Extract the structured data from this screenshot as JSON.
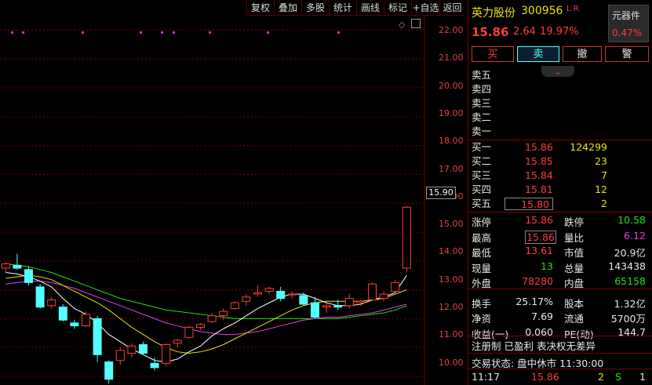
{
  "toolbar": [
    "复权",
    "叠加",
    "多股",
    "统计",
    "画线",
    "标记",
    "+自选",
    "返回"
  ],
  "y_axis": [
    "22.00",
    "21.00",
    "20.00",
    "19.00",
    "18.00",
    "17.00",
    "16.00",
    "15.00",
    "14.00",
    "13.00",
    "12.00",
    "11.00",
    "10.00"
  ],
  "current_price_marker": "15.90",
  "stock": {
    "name": "英力股份",
    "code": "300956",
    "tags": "L R",
    "price": "15.86",
    "change": "2.64",
    "change_pct": "19.97%",
    "unit_label": "元器件",
    "unit_pct": "0.47%"
  },
  "actions": [
    "买",
    "卖",
    "撤",
    "警"
  ],
  "sell_levels": [
    "卖五",
    "卖四",
    "卖三",
    "卖二",
    "卖一"
  ],
  "buy_levels": [
    {
      "label": "买一",
      "price": "15.86",
      "volume": "124299"
    },
    {
      "label": "买二",
      "price": "15.85",
      "volume": "23"
    },
    {
      "label": "买三",
      "price": "15.84",
      "volume": "7"
    },
    {
      "label": "买四",
      "price": "15.81",
      "volume": "12"
    },
    {
      "label": "买五",
      "price": "15.80",
      "volume": "2"
    }
  ],
  "stats": {
    "zhangting_label": "涨停",
    "zhangting": "15.86",
    "dieting_label": "跌停",
    "dieting": "10.58",
    "high_label": "最高",
    "high": "15.86",
    "liangbi_label": "量比",
    "liangbi": "6.12",
    "low_label": "最低",
    "low": "13.61",
    "shizhi_label": "市值",
    "shizhi": "20.9亿",
    "xianliang_label": "现量",
    "xianliang": "13",
    "zongliang_label": "总量",
    "zongliang": "143438",
    "waipan_label": "外盘",
    "waipan": "78280",
    "neipan_label": "内盘",
    "neipan": "65158",
    "huanshou_label": "换手",
    "huanshou": "25.17%",
    "guben_label": "股本",
    "guben": "1.32亿",
    "jingzi_label": "净资",
    "jingzi": "7.69",
    "liutong_label": "流通",
    "liutong": "5700万",
    "shouyi_label": "收益(一)",
    "shouyi": "0.060",
    "pe_label": "PE(动)",
    "pe": "144.7"
  },
  "info_line": "注册制 已盈利 表决权无差异",
  "status_line": "交易状态: 盘中休市 11:30:00",
  "tick": {
    "time": "11:17",
    "price": "15.86",
    "volume": "2",
    "side": "S",
    "count": "1"
  },
  "colors": {
    "up": "#ff3b3b",
    "down": "#54ffff",
    "ma5": "#ffffff",
    "ma10": "#e6e600",
    "ma20": "#e040e0",
    "ma60": "#22dd22"
  },
  "chart_data": {
    "type": "candlestick",
    "ylim": [
      9.7,
      22.5
    ],
    "ohlc": [
      [
        13.75,
        13.95,
        13.6,
        13.9
      ],
      [
        13.85,
        14.25,
        13.7,
        13.75
      ],
      [
        13.7,
        13.8,
        13.15,
        13.25
      ],
      [
        13.1,
        13.2,
        12.35,
        12.4
      ],
      [
        12.45,
        12.75,
        12.35,
        12.65
      ],
      [
        12.4,
        12.5,
        11.9,
        11.95
      ],
      [
        11.85,
        11.95,
        11.65,
        11.75
      ],
      [
        11.75,
        12.25,
        11.7,
        12.15
      ],
      [
        12.0,
        12.1,
        10.5,
        10.75
      ],
      [
        10.5,
        10.55,
        9.75,
        9.9
      ],
      [
        10.55,
        11.0,
        10.4,
        10.9
      ],
      [
        10.8,
        11.15,
        10.65,
        11.05
      ],
      [
        11.1,
        11.2,
        10.75,
        10.8
      ],
      [
        10.45,
        10.65,
        10.2,
        10.3
      ],
      [
        10.45,
        11.15,
        10.35,
        11.1
      ],
      [
        11.15,
        11.3,
        11.0,
        11.25
      ],
      [
        11.35,
        11.75,
        11.3,
        11.7
      ],
      [
        11.7,
        11.85,
        11.6,
        11.8
      ],
      [
        11.9,
        12.2,
        11.85,
        12.1
      ],
      [
        12.1,
        12.35,
        11.95,
        12.25
      ],
      [
        12.35,
        12.6,
        12.3,
        12.55
      ],
      [
        12.6,
        12.85,
        12.45,
        12.75
      ],
      [
        12.85,
        13.15,
        12.75,
        12.9
      ],
      [
        12.95,
        13.1,
        12.85,
        13.05
      ],
      [
        12.95,
        13.1,
        12.6,
        12.7
      ],
      [
        12.85,
        12.95,
        12.7,
        12.85
      ],
      [
        12.8,
        12.9,
        12.45,
        12.5
      ],
      [
        12.55,
        12.75,
        12.0,
        12.05
      ],
      [
        12.4,
        12.55,
        12.2,
        12.45
      ],
      [
        12.45,
        12.65,
        12.3,
        12.4
      ],
      [
        12.45,
        12.85,
        12.35,
        12.7
      ],
      [
        12.55,
        12.65,
        12.45,
        12.6
      ],
      [
        12.65,
        13.25,
        12.6,
        13.2
      ],
      [
        12.7,
        12.95,
        12.6,
        12.85
      ],
      [
        12.95,
        13.35,
        12.9,
        13.25
      ],
      [
        13.75,
        15.9,
        13.61,
        15.86
      ]
    ],
    "ma5": [
      13.6,
      13.55,
      13.45,
      13.3,
      13.1,
      12.7,
      12.35,
      12.15,
      11.85,
      11.45,
      11.2,
      10.95,
      10.75,
      10.55,
      10.5,
      10.6,
      10.85,
      11.05,
      11.4,
      11.65,
      11.85,
      12.1,
      12.35,
      12.55,
      12.75,
      12.85,
      12.85,
      12.7,
      12.55,
      12.45,
      12.45,
      12.5,
      12.65,
      12.75,
      12.9,
      13.5
    ],
    "ma10": [
      13.4,
      13.45,
      13.5,
      13.45,
      13.35,
      13.15,
      12.95,
      12.75,
      12.55,
      12.3,
      12.0,
      11.7,
      11.45,
      11.2,
      11.0,
      10.85,
      10.8,
      10.85,
      10.95,
      11.1,
      11.3,
      11.5,
      11.7,
      11.9,
      12.1,
      12.3,
      12.45,
      12.55,
      12.6,
      12.6,
      12.6,
      12.6,
      12.65,
      12.7,
      12.85,
      13.0
    ],
    "ma20": [
      13.2,
      13.25,
      13.3,
      13.3,
      13.25,
      13.15,
      13.05,
      12.9,
      12.75,
      12.6,
      12.45,
      12.3,
      12.15,
      12.0,
      11.85,
      11.75,
      11.65,
      11.55,
      11.5,
      11.45,
      11.45,
      11.5,
      11.55,
      11.65,
      11.75,
      11.85,
      11.95,
      12.0,
      12.05,
      12.05,
      12.1,
      12.15,
      12.2,
      12.3,
      12.4,
      12.5
    ],
    "ma60": [
      13.9,
      13.85,
      13.8,
      13.7,
      13.6,
      13.45,
      13.3,
      13.15,
      13.0,
      12.85,
      12.7,
      12.6,
      12.5,
      12.4,
      12.3,
      12.25,
      12.2,
      12.15,
      12.1,
      12.05,
      12.0,
      12.0,
      12.0,
      12.0,
      12.0,
      12.0,
      12.0,
      12.0,
      12.0,
      12.0,
      12.05,
      12.1,
      12.15,
      12.2,
      12.3,
      12.45
    ]
  }
}
